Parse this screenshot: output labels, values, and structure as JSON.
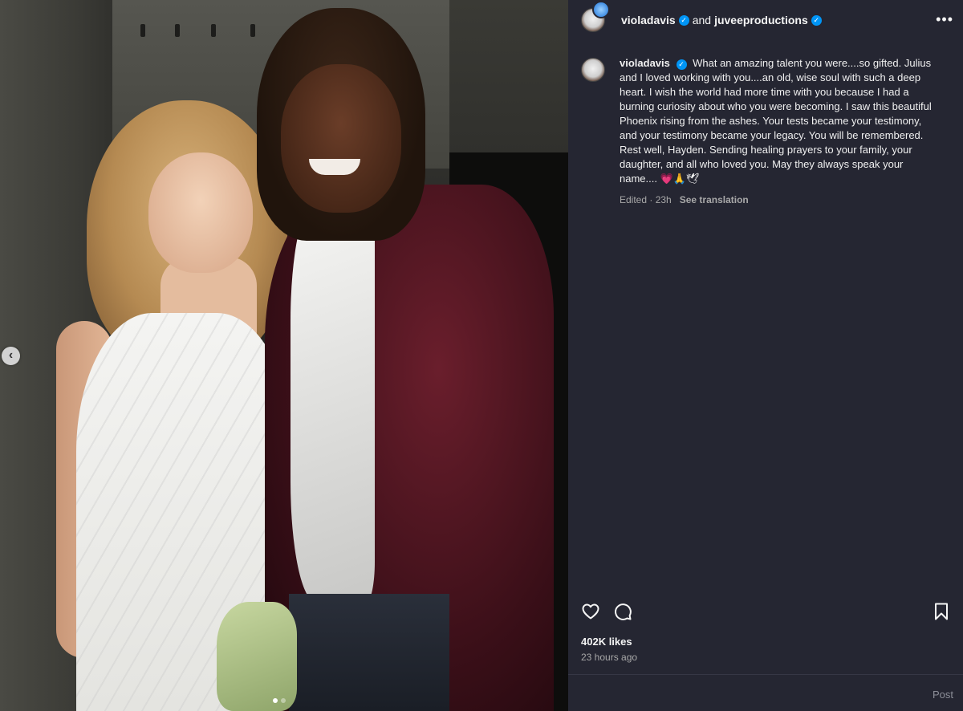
{
  "header": {
    "username": "violadavis",
    "conjunction": "and",
    "collaborator": "juveeproductions",
    "more_label": "•••"
  },
  "caption": {
    "username": "violadavis",
    "text": "What an amazing talent you were....so gifted. Julius and I loved working with you....an old, wise soul with such a deep heart. I wish the world had more time with you because I had a burning curiosity about who you were becoming. I saw this beautiful Phoenix rising from the ashes. Your tests became your testimony, and your testimony became your legacy. You will be remembered. Rest well, Hayden. Sending healing prayers to your family, your daughter, and all who loved you. May they always speak your name.... 💗🙏🕊",
    "edited": "Edited · 23h",
    "translate": "See translation"
  },
  "media": {
    "prev_arrow": "‹",
    "carousel_count": 2,
    "carousel_active": 0
  },
  "actions": {
    "like_icon": "heart-icon",
    "comment_icon": "comment-icon",
    "save_icon": "bookmark-icon"
  },
  "stats": {
    "likes": "402K likes",
    "posted": "23 hours ago"
  },
  "comment_box": {
    "post_label": "Post"
  },
  "colors": {
    "panel_bg": "#252632",
    "verified": "#0095f6",
    "muted_text": "#a8a8a8"
  }
}
